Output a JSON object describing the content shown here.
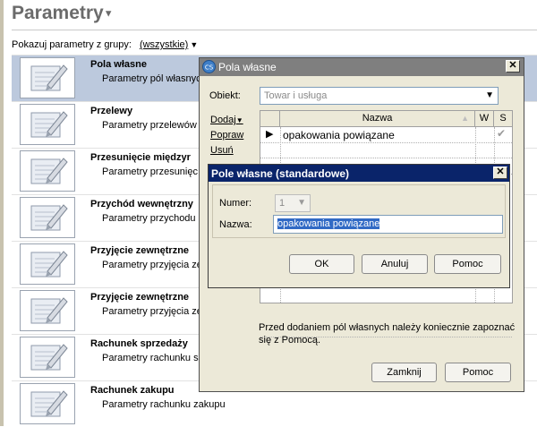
{
  "page": {
    "title": "Parametry",
    "filter_label": "Pokazuj parametry z grupy:",
    "filter_value": "(wszystkie)"
  },
  "params": [
    {
      "title": "Pola własne",
      "desc": "Parametry pól własnych"
    },
    {
      "title": "Przelewy",
      "desc": "Parametry przelewów"
    },
    {
      "title": "Przesunięcie międzyr",
      "desc": "Parametry przesunięc"
    },
    {
      "title": "Przychód wewnętrzny",
      "desc": "Parametry przychodu"
    },
    {
      "title": "Przyjęcie zewnętrzne",
      "desc": "Parametry przyjęcia ze"
    },
    {
      "title": "Przyjęcie zewnętrzne",
      "desc": "Parametry przyjęcia ze"
    },
    {
      "title": "Rachunek sprzedaży",
      "desc": "Parametry rachunku sp"
    },
    {
      "title": "Rachunek zakupu",
      "desc": "Parametry rachunku zakupu"
    }
  ],
  "dialog_outer": {
    "title": "Pola własne",
    "close": "✕",
    "obiekt_label": "Obiekt:",
    "obiekt_value": "Towar i usługa",
    "actions": {
      "add": "Dodaj",
      "edit": "Popraw",
      "delete": "Usuń"
    },
    "columns": {
      "name": "Nazwa",
      "w": "W",
      "s": "S"
    },
    "row": {
      "name": "opakowania powiązane"
    },
    "note": "Przed dodaniem pól własnych należy koniecznie zapoznać się z Pomocą.",
    "btn_close": "Zamknij",
    "btn_help": "Pomoc"
  },
  "dialog_inner": {
    "title": "Pole własne (standardowe)",
    "close": "✕",
    "numer_label": "Numer:",
    "numer_value": "1",
    "nazwa_label": "Nazwa:",
    "nazwa_value": "opakowania powiązane",
    "btn_ok": "OK",
    "btn_cancel": "Anuluj",
    "btn_help": "Pomoc"
  }
}
